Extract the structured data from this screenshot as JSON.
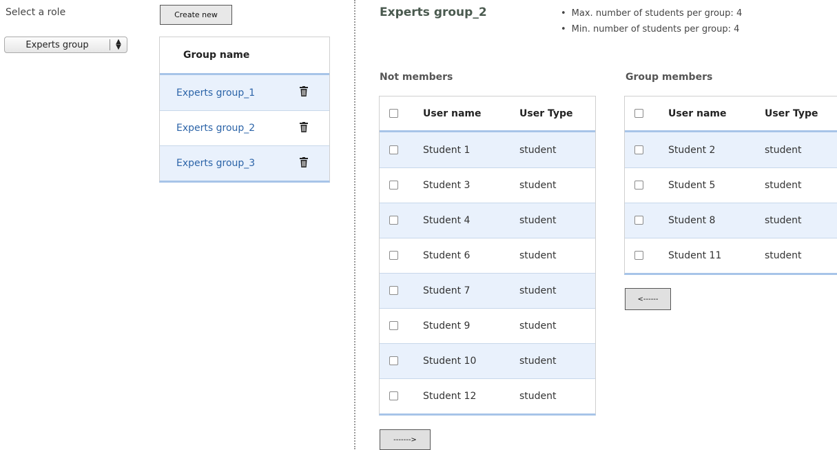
{
  "left": {
    "role_label": "Select a role",
    "role_select": {
      "selected": "Experts group"
    },
    "create_button": "Create new",
    "group_table": {
      "header": "Group name",
      "rows": [
        {
          "name": "Experts group_1",
          "icon": "trash-icon"
        },
        {
          "name": "Experts group_2",
          "icon": "trash-icon"
        },
        {
          "name": "Experts group_3",
          "icon": "trash-icon"
        }
      ]
    }
  },
  "detail": {
    "title": "Experts group_2",
    "limits": [
      "Max. number of students per group: 4",
      "Min. number of students per group: 4"
    ],
    "not_members": {
      "heading": "Not members",
      "columns": [
        "User name",
        "User Type"
      ],
      "rows": [
        {
          "user": "Student 1",
          "type": "student"
        },
        {
          "user": "Student 3",
          "type": "student"
        },
        {
          "user": "Student 4",
          "type": "student"
        },
        {
          "user": "Student 6",
          "type": "student"
        },
        {
          "user": "Student 7",
          "type": "student"
        },
        {
          "user": "Student 9",
          "type": "student"
        },
        {
          "user": "Student 10",
          "type": "student"
        },
        {
          "user": "Student 12",
          "type": "student"
        }
      ],
      "move_button": "------->"
    },
    "members": {
      "heading": "Group members",
      "columns": [
        "User name",
        "User Type"
      ],
      "rows": [
        {
          "user": "Student 2",
          "type": "student"
        },
        {
          "user": "Student 5",
          "type": "student"
        },
        {
          "user": "Student 8",
          "type": "student"
        },
        {
          "user": "Student 11",
          "type": "student"
        }
      ],
      "move_button": "<------"
    }
  },
  "colors": {
    "link": "#2c64a8",
    "row_alt": "#e9f1fc",
    "accent_border": "#a7c4e8"
  }
}
